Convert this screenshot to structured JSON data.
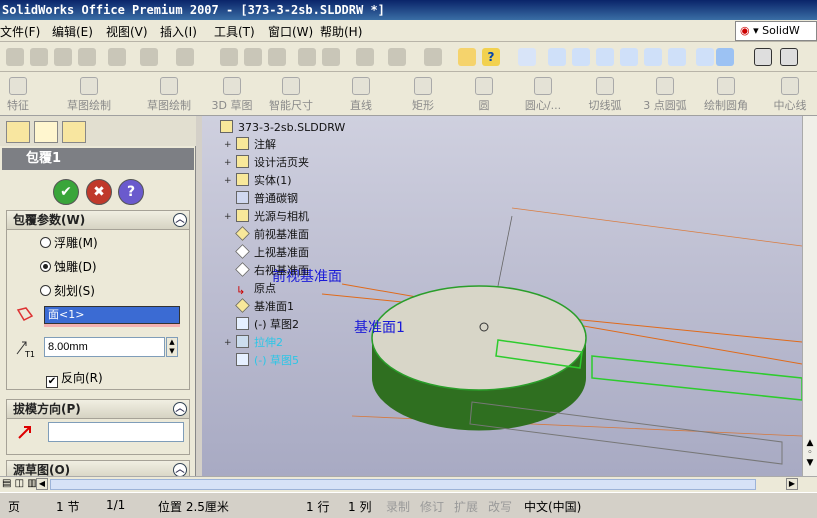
{
  "window": {
    "title": "SolidWorks Office Premium 2007 - [373-3-2sb.SLDDRW *]"
  },
  "menubar": {
    "items": [
      "文件(F)",
      "编辑(E)",
      "视图(V)",
      "插入(I)",
      "工具(T)",
      "窗口(W)",
      "帮助(H)"
    ],
    "brand": "SolidW"
  },
  "sketch_toolbar": {
    "items": [
      "特征",
      "草图绘制",
      "草图绘制",
      "3D 草图",
      "智能尺寸",
      "直线",
      "矩形",
      "圆",
      "圆心/...",
      "切线弧",
      "3 点圆弧",
      "绘制圆角",
      "中心线"
    ]
  },
  "property_manager": {
    "feature_title": "包覆1",
    "ok": "✔",
    "cancel": "✖",
    "help": "?",
    "wrap_params": {
      "header": "包覆参数(W)",
      "options": [
        "浮雕(M)",
        "蚀雕(D)",
        "刻划(S)"
      ],
      "selected": "蚀雕(D)",
      "face_value": "面<1>",
      "thickness": "8.00mm",
      "reverse_label": "反向(R)",
      "reverse_checked": true
    },
    "draft_direction": {
      "header": "拔模方向(P)"
    },
    "source_sketch": {
      "header": "源草图(O)"
    }
  },
  "feature_tree": {
    "root": "373-3-2sb.SLDDRW",
    "items": [
      {
        "label": "注解",
        "expandable": true
      },
      {
        "label": "设计活页夹",
        "expandable": true
      },
      {
        "label": "实体(1)",
        "expandable": true
      },
      {
        "label": "普通碳钢",
        "expandable": false
      },
      {
        "label": "光源与相机",
        "expandable": true
      },
      {
        "label": "前视基准面",
        "expandable": false
      },
      {
        "label": "上视基准面",
        "expandable": false
      },
      {
        "label": "右视基准面",
        "expandable": false
      },
      {
        "label": "原点",
        "expandable": false
      },
      {
        "label": "基准面1",
        "expandable": false
      },
      {
        "label": "(-) 草图2",
        "expandable": false
      },
      {
        "label": "拉伸2",
        "expandable": true
      },
      {
        "label": "(-) 草图5",
        "expandable": false
      }
    ]
  },
  "viewport": {
    "plane_label_front": "前视基准面",
    "plane_label_1": "基准面1"
  },
  "statusbar": {
    "page": "页",
    "section": "1 节",
    "page_of": "1/1",
    "position": "位置 2.5厘米",
    "line": "1 行",
    "column": "1 列",
    "record": "录制",
    "revision": "修订",
    "extend": "扩展",
    "overtype": "改写",
    "language": "中文(中国)"
  }
}
